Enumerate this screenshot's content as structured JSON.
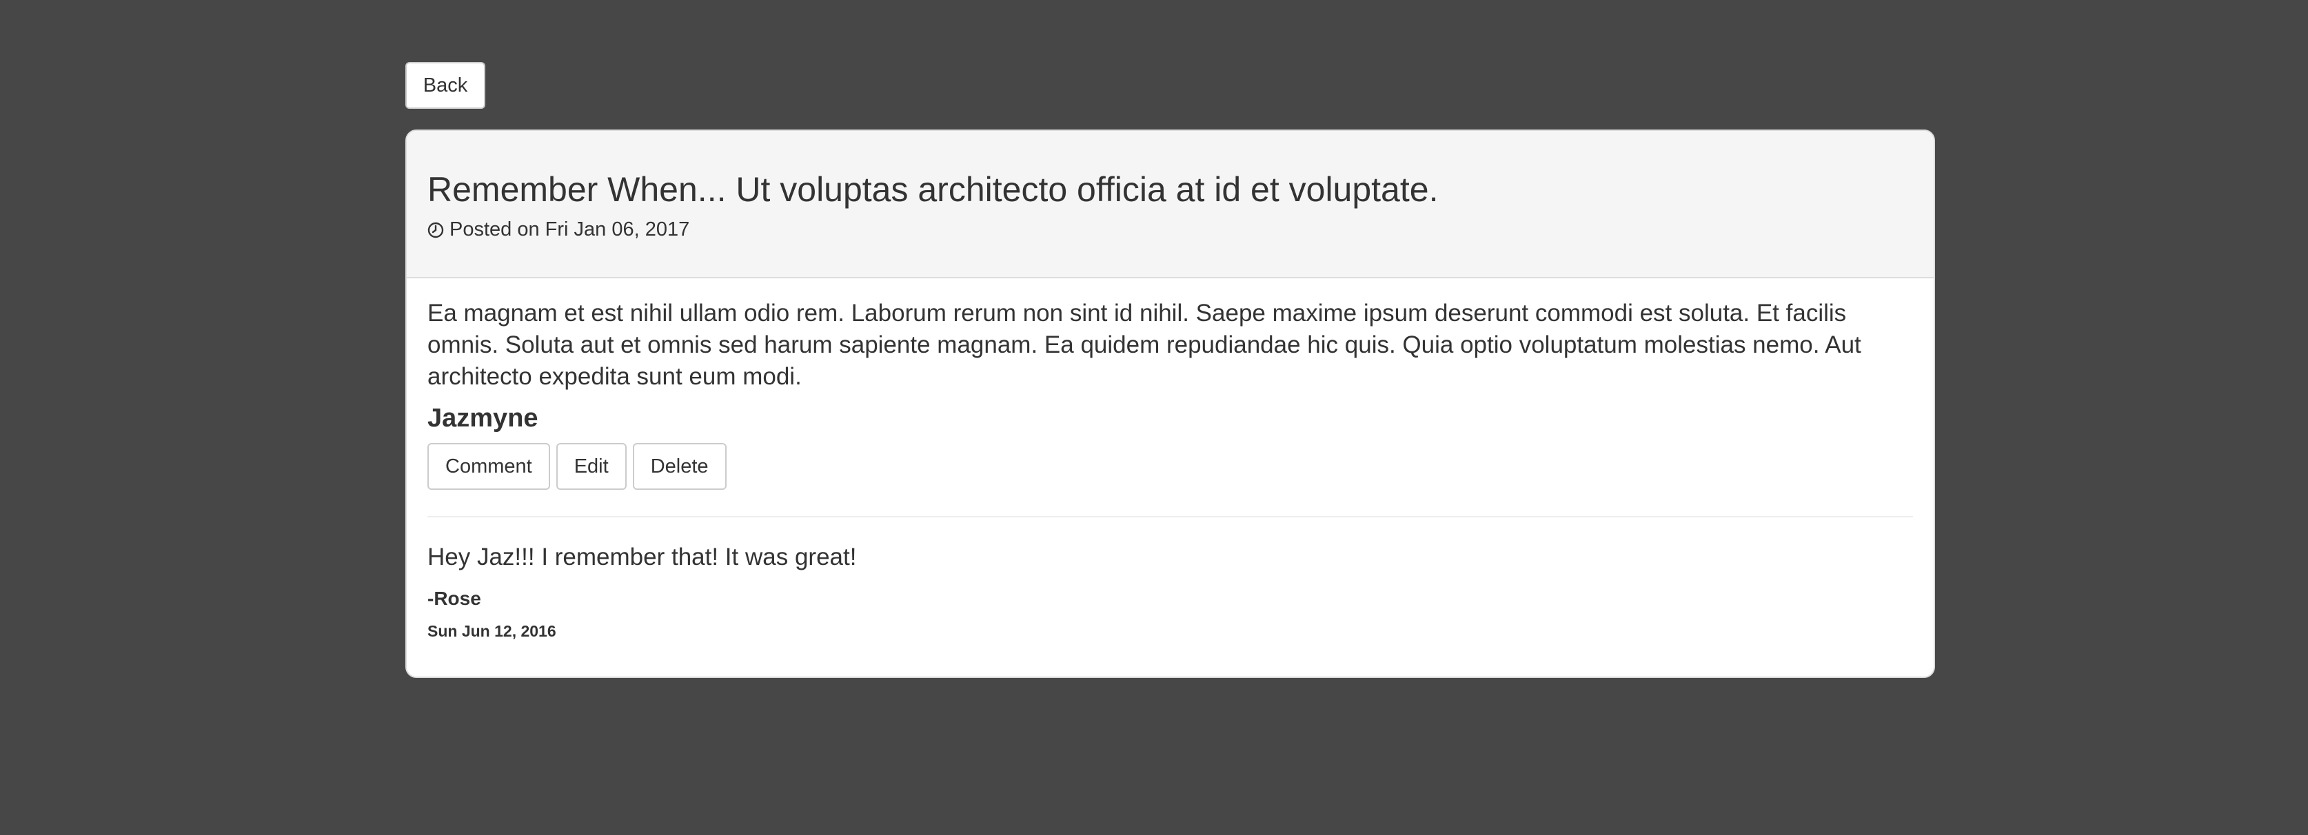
{
  "nav": {
    "back_label": "Back"
  },
  "post": {
    "title": "Remember When... Ut voluptas architecto officia at id et voluptate.",
    "posted_on": "Posted on Fri Jan 06, 2017",
    "body": "Ea magnam et est nihil ullam odio rem. Laborum rerum non sint id nihil. Saepe maxime ipsum deserunt commodi est soluta. Et facilis omnis. Soluta aut et omnis sed harum sapiente magnam. Ea quidem repudiandae hic quis. Quia optio voluptatum molestias nemo. Aut architecto expedita sunt eum modi.",
    "author": "Jazmyne",
    "icon": "clock-icon"
  },
  "actions": {
    "comment_label": "Comment",
    "edit_label": "Edit",
    "delete_label": "Delete"
  },
  "comments": [
    {
      "text": "Hey Jaz!!! I remember that! It was great!",
      "author": "-Rose",
      "date": "Sun Jun 12, 2016"
    }
  ],
  "colors": {
    "page_background": "#474747",
    "panel_heading_background": "#f5f5f5",
    "text": "#333333"
  }
}
